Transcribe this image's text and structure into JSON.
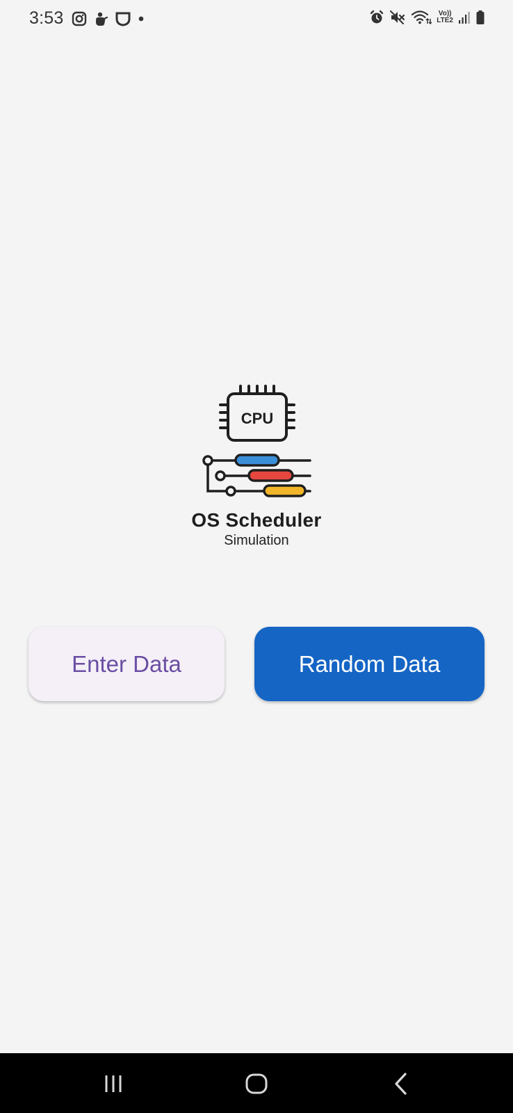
{
  "status_bar": {
    "time": "3:53",
    "left_icons": [
      "instagram-icon",
      "hand-icon",
      "shield-icon",
      "dot-icon"
    ],
    "right_icons": [
      "alarm-icon",
      "mute-icon",
      "wifi-icon",
      "volte-lte2-icon",
      "signal-icon",
      "battery-icon"
    ],
    "network_label_top": "Vo))",
    "network_label_bottom": "LTE2"
  },
  "logo": {
    "cpu_label": "CPU",
    "title": "OS Scheduler",
    "subtitle": "Simulation",
    "bar_colors": [
      "#3b8ed8",
      "#e5473f",
      "#f1b52a"
    ],
    "outline_color": "#1f1f1f"
  },
  "actions": {
    "enter_data_label": "Enter Data",
    "random_data_label": "Random Data",
    "enter_bg": "#f5f0f8",
    "enter_text_color": "#6a4ea3",
    "random_bg": "#1565c4"
  },
  "nav_bar": {
    "recent_icon": "recent-apps-icon",
    "home_icon": "home-icon",
    "back_icon": "back-icon"
  }
}
